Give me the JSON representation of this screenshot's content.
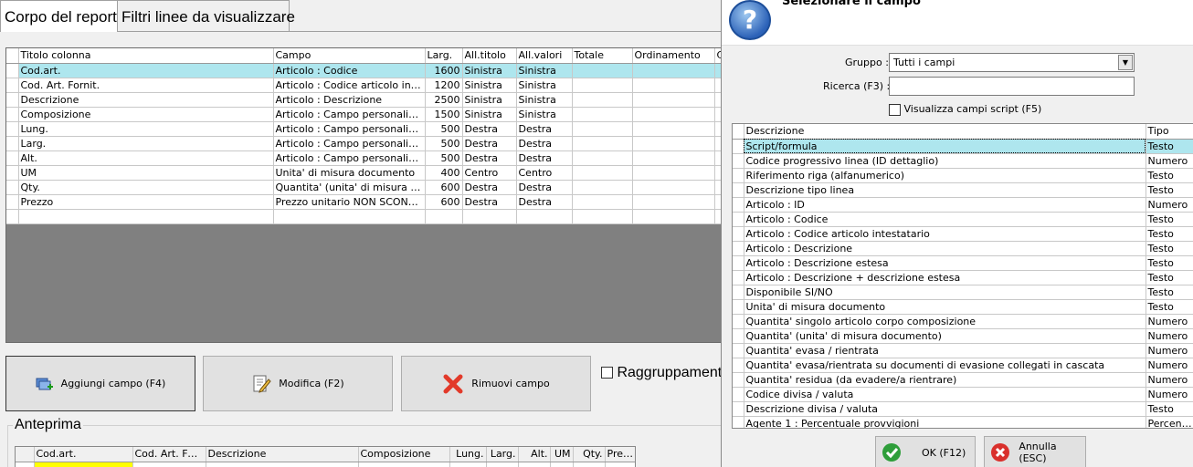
{
  "tabs": [
    {
      "label": "Corpo del report",
      "active": true
    },
    {
      "label": "Filtri linee da visualizzare",
      "active": false
    }
  ],
  "main_grid": {
    "headers": [
      "Titolo colonna",
      "Campo",
      "Larg.",
      "All.titolo",
      "All.valori",
      "Totale",
      "Ordinamento",
      "C"
    ],
    "rows": [
      [
        "Cod.art.",
        "Articolo : Codice",
        "1600",
        "Sinistra",
        "Sinistra",
        "",
        ""
      ],
      [
        "Cod. Art. Fornit.",
        "Articolo : Codice articolo intestatario",
        "1200",
        "Sinistra",
        "Sinistra",
        "",
        ""
      ],
      [
        "Descrizione",
        "Articolo : Descrizione",
        "2500",
        "Sinistra",
        "Sinistra",
        "",
        ""
      ],
      [
        "Composizione",
        "Articolo : Campo personalizzato composizione",
        "1500",
        "Sinistra",
        "Sinistra",
        "",
        ""
      ],
      [
        "Lung.",
        "Articolo : Campo personalizzato lunghezza",
        "500",
        "Destra",
        "Destra",
        "",
        ""
      ],
      [
        "Larg.",
        "Articolo : Campo personalizzato larghezza",
        "500",
        "Destra",
        "Destra",
        "",
        ""
      ],
      [
        "Alt.",
        "Articolo : Campo personalizzato altezza",
        "500",
        "Destra",
        "Destra",
        "",
        ""
      ],
      [
        "UM",
        "Unita' di misura documento",
        "400",
        "Centro",
        "Centro",
        "",
        ""
      ],
      [
        "Qty.",
        "Quantita' (unita' di misura documento)",
        "600",
        "Destra",
        "Destra",
        "",
        ""
      ],
      [
        "Prezzo",
        "Prezzo unitario NON SCONTATO",
        "600",
        "Destra",
        "Destra",
        "",
        ""
      ]
    ],
    "selected_row": 0
  },
  "buttons": {
    "add": "Aggiungi campo (F4)",
    "edit": "Modifica (F2)",
    "remove": "Rimuovi campo"
  },
  "grouping_label": "Raggruppamenti",
  "preview": {
    "title": "Anteprima",
    "headers": [
      "Cod.art.",
      "Cod. Art. Fornit.",
      "Descrizione",
      "Composizione",
      "Lung.",
      "Larg.",
      "Alt.",
      "UM",
      "Qty.",
      "Prezzo"
    ]
  },
  "dialog": {
    "title": "Selezionare il campo",
    "group_label": "Gruppo :",
    "group_value": "Tutti i campi",
    "search_label": "Ricerca (F3) :",
    "search_value": "",
    "show_script_label": "Visualizza campi script (F5)",
    "headers": [
      "Descrizione",
      "Tipo"
    ],
    "rows": [
      [
        "Script/formula",
        "Testo"
      ],
      [
        "Codice progressivo linea (ID dettaglio)",
        "Numero"
      ],
      [
        "Riferimento riga (alfanumerico)",
        "Testo"
      ],
      [
        "Descrizione tipo linea",
        "Testo"
      ],
      [
        "Articolo : ID",
        "Numero"
      ],
      [
        "Articolo : Codice",
        "Testo"
      ],
      [
        "Articolo : Codice articolo intestatario",
        "Testo"
      ],
      [
        "Articolo : Descrizione",
        "Testo"
      ],
      [
        "Articolo : Descrizione estesa",
        "Testo"
      ],
      [
        "Articolo : Descrizione + descrizione estesa",
        "Testo"
      ],
      [
        "Disponibile SI/NO",
        "Testo"
      ],
      [
        "Unita' di misura documento",
        "Testo"
      ],
      [
        "Quantita' singolo articolo corpo composizione",
        "Numero"
      ],
      [
        "Quantita' (unita' di misura documento)",
        "Numero"
      ],
      [
        "Quantita' evasa / rientrata",
        "Numero"
      ],
      [
        "Quantita' evasa/rientrata su documenti di evasione collegati in cascata",
        "Numero"
      ],
      [
        "Quantita' residua (da evadere/a rientrare)",
        "Numero"
      ],
      [
        "Codice divisa / valuta",
        "Numero"
      ],
      [
        "Descrizione divisa / valuta",
        "Testo"
      ],
      [
        "Agente 1 : Percentuale provvigioni",
        "Percentuale"
      ]
    ],
    "selected_row": 0,
    "ok_label": "OK (F12)",
    "cancel_label": "Annulla (ESC)"
  },
  "colors": {
    "selection": "#aee6ee",
    "preview_highlight": "#ffff00",
    "ok_green": "#2e9e3a",
    "cancel_red": "#d9302c"
  }
}
